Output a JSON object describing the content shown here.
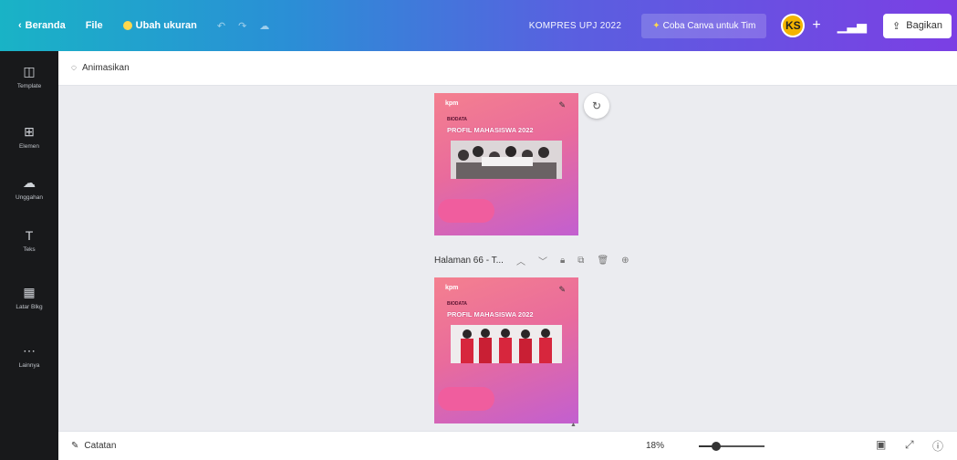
{
  "topbar": {
    "home_label": "Beranda",
    "file_label": "File",
    "resize_label": "Ubah ukuran",
    "doc_title": "KOMPRES UPJ 2022",
    "try_label": "Coba Canva untuk Tim",
    "avatar_initials": "KS",
    "share_label": "Bagikan"
  },
  "sidebar": {
    "items": [
      {
        "label": "Template",
        "icon": "template-icon"
      },
      {
        "label": "Elemen",
        "icon": "elements-icon"
      },
      {
        "label": "Unggahan",
        "icon": "upload-icon"
      },
      {
        "label": "Teks",
        "icon": "text-icon"
      },
      {
        "label": "Latar Blkg",
        "icon": "background-icon"
      },
      {
        "label": "Lainnya",
        "icon": "more-icon"
      }
    ]
  },
  "editor": {
    "animate_label": "Animasikan",
    "page_label": "Halaman 66 - T...",
    "cards": [
      {
        "logo": "kpm",
        "subtitle": "BIODATA",
        "headline": "PROFIL MAHASISWA 2022"
      },
      {
        "logo": "kpm",
        "subtitle": "BIODATA",
        "headline": "PROFIL MAHASISWA 2022"
      }
    ]
  },
  "bottombar": {
    "notes_label": "Catatan",
    "zoom_label": "18%",
    "zoom_value": 0.18
  }
}
